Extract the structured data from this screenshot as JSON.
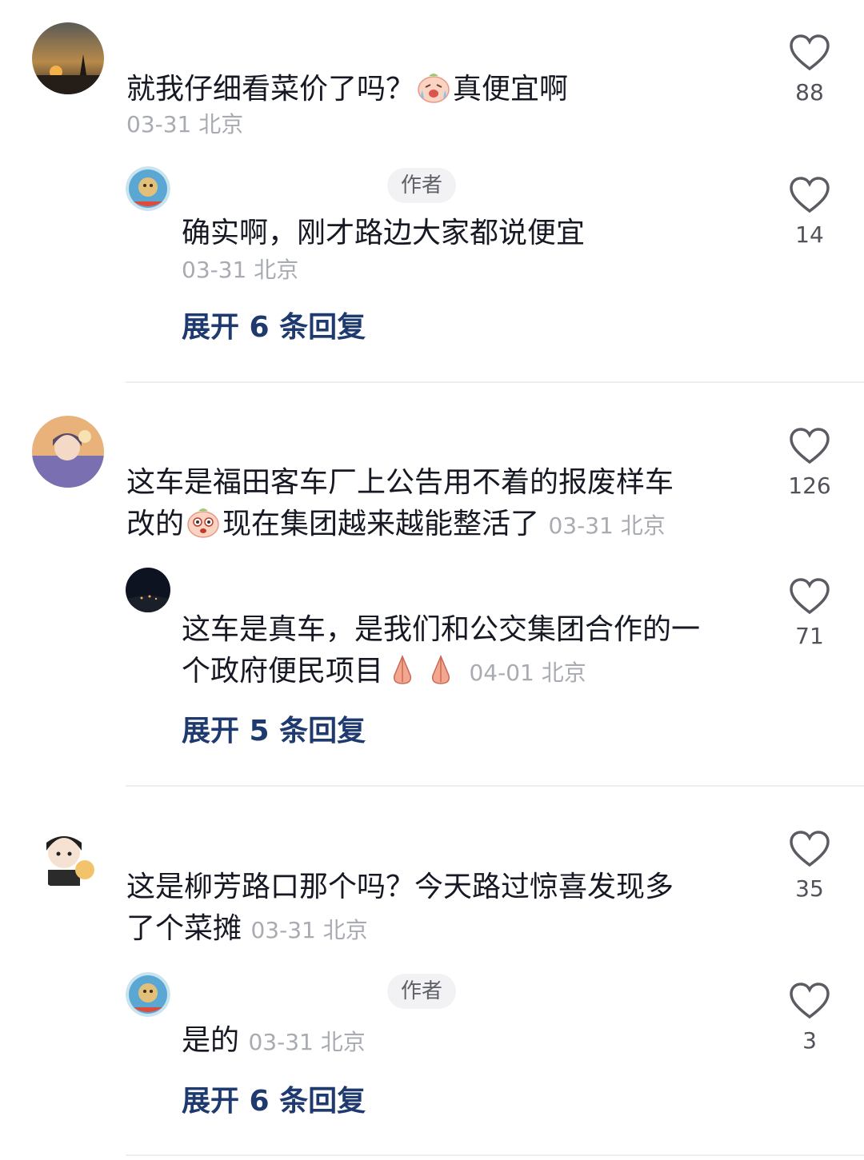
{
  "comments": [
    {
      "text_before": "就我仔细看菜价了吗？",
      "text_after": "真便宜啊",
      "emoji": "laughing-crying-face",
      "meta": "03-31 北京",
      "likes": "88",
      "reply": {
        "author_tag": "作者",
        "text": "确实啊，刚才路边大家都说便宜",
        "meta": "03-31 北京",
        "likes": "14"
      },
      "expand_label": "展开 6 条回复"
    },
    {
      "text_line1": "这车是福田客车厂上公告用不着的报废样车",
      "text_line2_before": "改的",
      "text_line2_after": "现在集团越来越能整活了",
      "emoji": "crying-face",
      "meta": "03-31 北京",
      "likes": "126",
      "reply": {
        "text_line1": "这车是真车，是我们和公交集团合作的一",
        "text_line2": "个政府便民项目",
        "emoji": "praying-hands",
        "meta": "04-01 北京",
        "likes": "71"
      },
      "expand_label": "展开 5 条回复"
    },
    {
      "text_line1": "这是柳芳路口那个吗？今天路过惊喜发现多",
      "text_line2": "了个菜摊",
      "meta": "03-31 北京",
      "likes": "35",
      "reply": {
        "author_tag": "作者",
        "text": "是的",
        "meta": "03-31 北京",
        "likes": "3"
      },
      "expand_label": "展开 6 条回复"
    }
  ],
  "colors": {
    "text": "#161823",
    "meta": "#a9abb2",
    "expand": "#1e3a6e",
    "divider": "#eeeeef"
  }
}
